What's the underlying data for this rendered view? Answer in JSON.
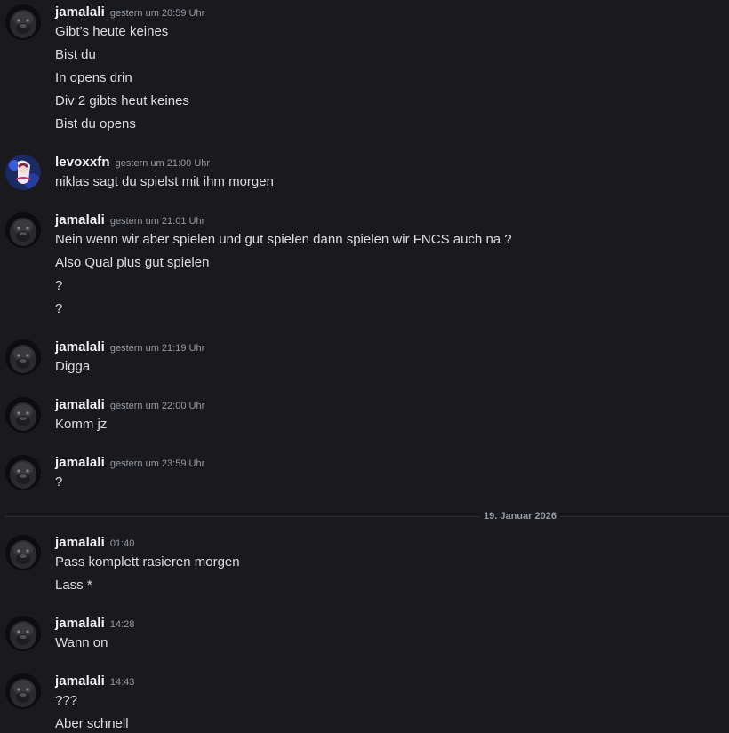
{
  "messages": [
    {
      "user": "jamalali",
      "time": "gestern um 20:59 Uhr",
      "avatar": "gorilla-avatar",
      "lines": [
        "Gibt’s heute keines",
        "Bist du",
        "In opens drin",
        "Div 2 gibts heut keines",
        "Bist du opens"
      ]
    },
    {
      "user": "levoxxfn",
      "time": "gestern um 21:00 Uhr",
      "avatar": "anime-avatar",
      "lines": [
        "niklas sagt du spielst mit ihm morgen"
      ]
    },
    {
      "user": "jamalali",
      "time": "gestern um 21:01 Uhr",
      "avatar": "gorilla-avatar",
      "lines": [
        "Nein wenn wir aber spielen und gut spielen dann spielen wir FNCS auch na ?",
        "Also Qual plus gut spielen",
        "?",
        "?"
      ]
    },
    {
      "user": "jamalali",
      "time": "gestern um 21:19 Uhr",
      "avatar": "gorilla-avatar",
      "lines": [
        "Digga"
      ]
    },
    {
      "user": "jamalali",
      "time": "gestern um 22:00 Uhr",
      "avatar": "gorilla-avatar",
      "lines": [
        "Komm jz"
      ]
    },
    {
      "user": "jamalali",
      "time": "gestern um 23:59 Uhr",
      "avatar": "gorilla-avatar",
      "lines": [
        "?"
      ]
    },
    {
      "user": "jamalali",
      "time": "01:40",
      "avatar": "gorilla-avatar",
      "lines": [
        "Pass komplett rasieren morgen",
        "Lass *"
      ]
    },
    {
      "user": "jamalali",
      "time": "14:28",
      "avatar": "gorilla-avatar",
      "lines": [
        "Wann on"
      ]
    },
    {
      "user": "jamalali",
      "time": "14:43",
      "avatar": "gorilla-avatar",
      "lines": [
        "???",
        "Aber schnell"
      ]
    }
  ],
  "divider": {
    "label": "19. Januar 2026"
  },
  "colors": {
    "background": "#1a1a1e",
    "username": "#f2f3f5",
    "timestamp": "#949ba4",
    "text": "#dbdee1"
  }
}
